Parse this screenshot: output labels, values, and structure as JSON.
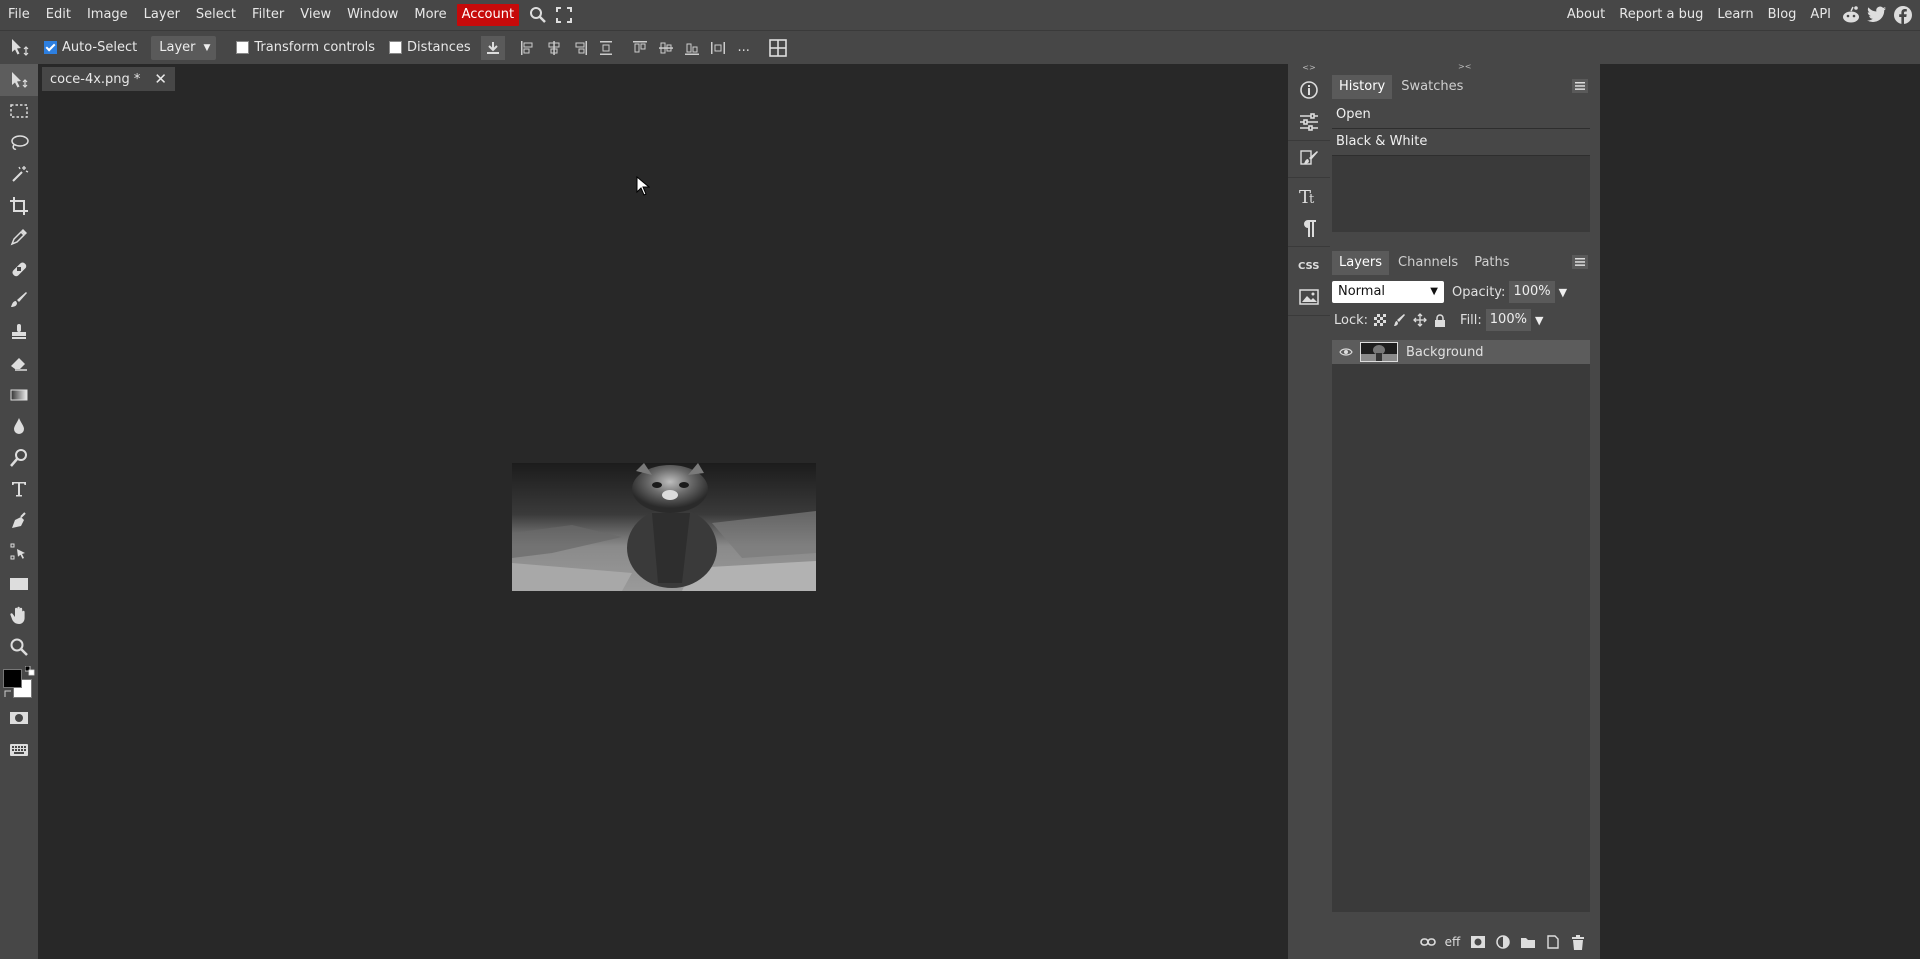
{
  "menubar": {
    "items": [
      "File",
      "Edit",
      "Image",
      "Layer",
      "Select",
      "Filter",
      "View",
      "Window",
      "More"
    ],
    "account": "Account",
    "right_links": [
      "About",
      "Report a bug",
      "Learn",
      "Blog",
      "API"
    ],
    "accent_color": "#c60a0a"
  },
  "options": {
    "auto_select_label": "Auto-Select",
    "auto_select_checked": true,
    "layer_select_value": "Layer",
    "transform_controls_label": "Transform controls",
    "distances_label": "Distances",
    "more_label": "..."
  },
  "document": {
    "tab_title": "coce-4x.png *",
    "close_label": "✕"
  },
  "history": {
    "tabs": [
      "History",
      "Swatches"
    ],
    "items": [
      "Open",
      "Black & White"
    ]
  },
  "layers": {
    "tabs": [
      "Layers",
      "Channels",
      "Paths"
    ],
    "blend_mode": "Normal",
    "opacity_label": "Opacity:",
    "opacity_value": "100%",
    "lock_label": "Lock:",
    "fill_label": "Fill:",
    "fill_value": "100%",
    "items": [
      {
        "name": "Background",
        "visible": true
      }
    ],
    "footer_eff": "eff"
  }
}
